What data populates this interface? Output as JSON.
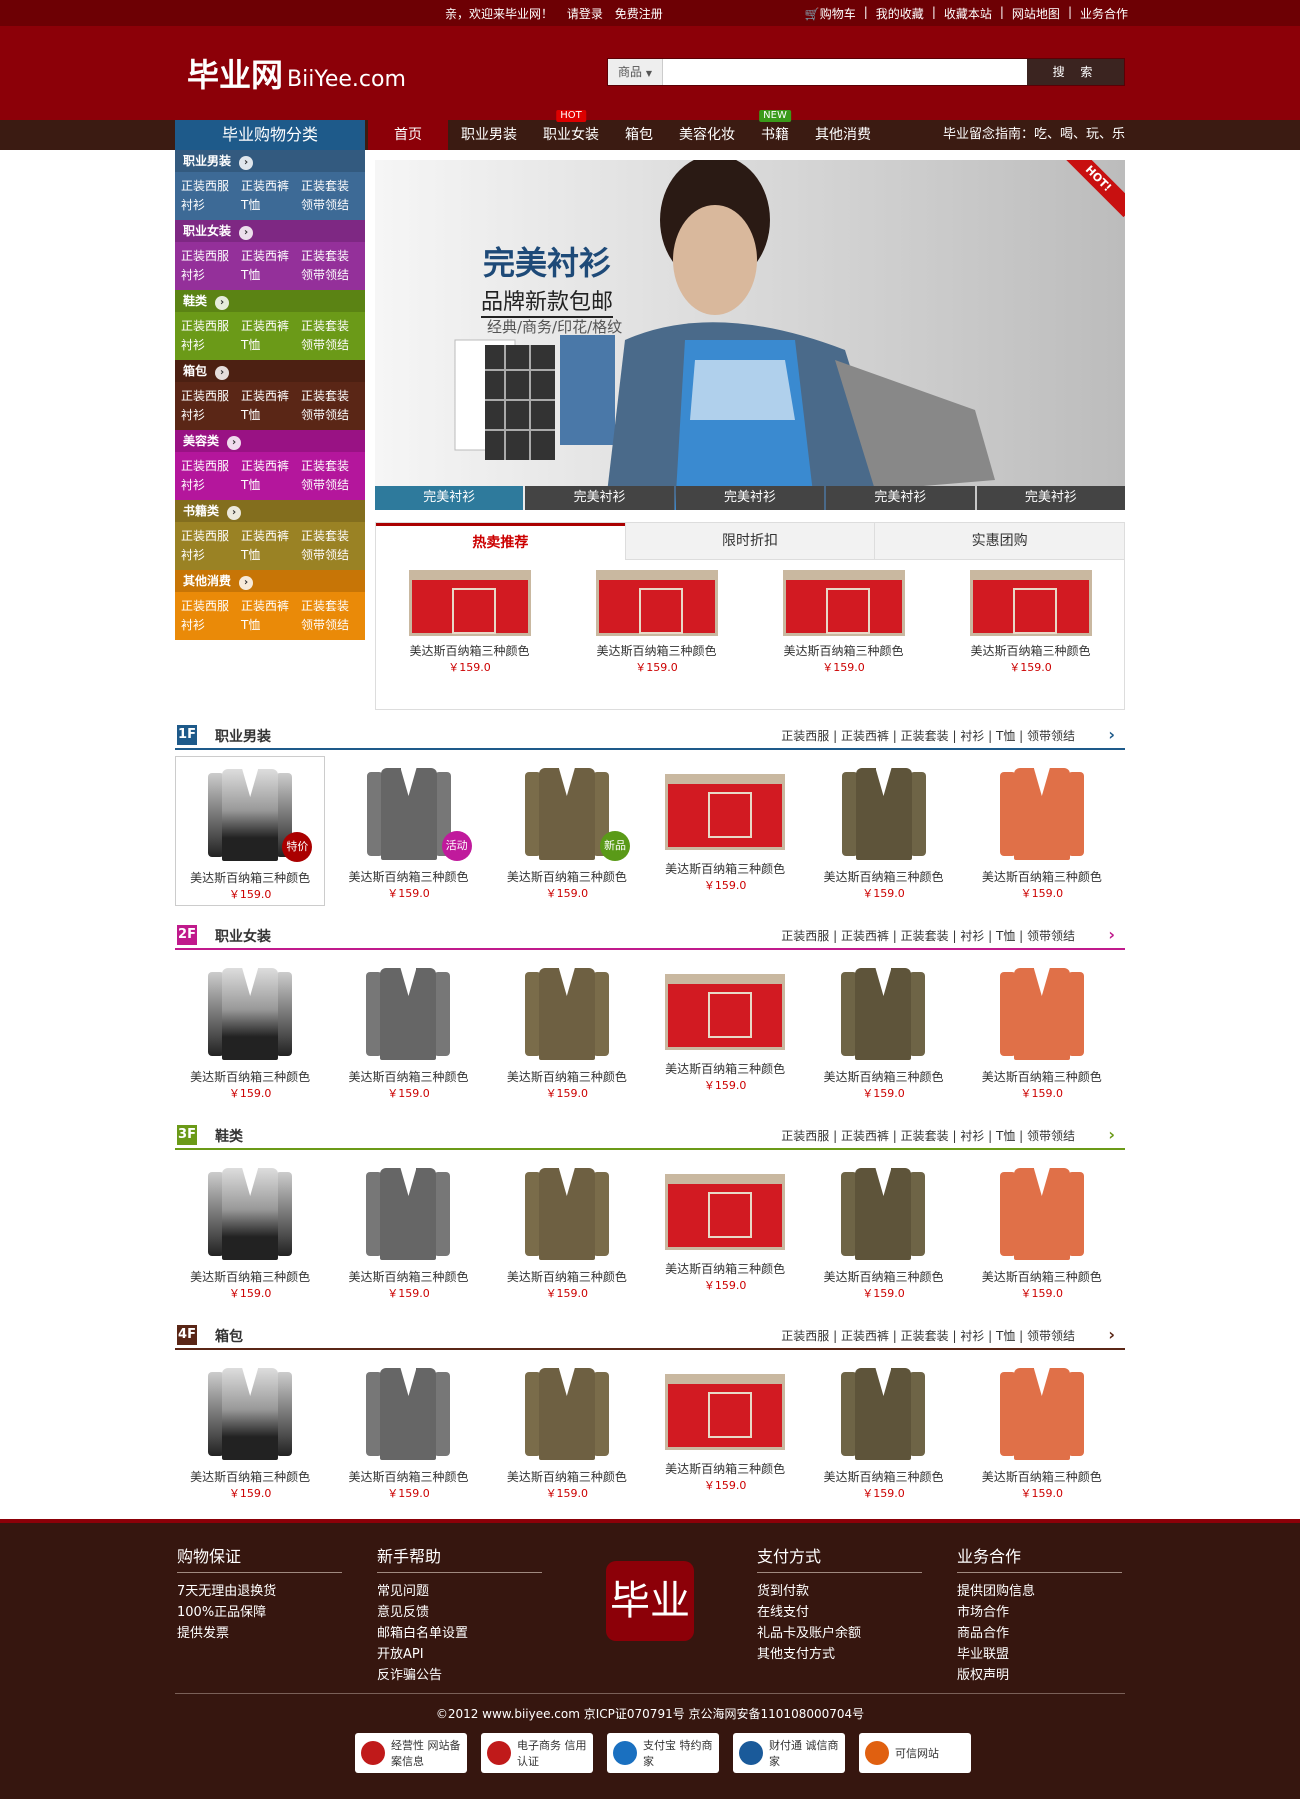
{
  "topbar": {
    "welcome": "亲，欢迎来毕业网！",
    "login": "请登录",
    "register": "免费注册",
    "links": [
      "购物车",
      "我的收藏",
      "收藏本站",
      "网站地图",
      "业务合作"
    ]
  },
  "logo": {
    "cn": "毕业网",
    "en": "BiiYee.com"
  },
  "search": {
    "category": "商品",
    "button": "搜 索",
    "placeholder": ""
  },
  "nav": {
    "category_title": "毕业购物分类",
    "items": [
      {
        "label": "首页",
        "badge": ""
      },
      {
        "label": "职业男装",
        "badge": ""
      },
      {
        "label": "职业女装",
        "badge": "HOT"
      },
      {
        "label": "箱包",
        "badge": ""
      },
      {
        "label": "美容化妆",
        "badge": ""
      },
      {
        "label": "书籍",
        "badge": "NEW"
      },
      {
        "label": "其他消费",
        "badge": ""
      }
    ],
    "guide": "毕业留念指南：吃、喝、玩、乐"
  },
  "sidebar": [
    {
      "title": "职业男装",
      "color": "#3d6a96"
    },
    {
      "title": "职业女装",
      "color": "#94309a"
    },
    {
      "title": "鞋类",
      "color": "#6b9a18"
    },
    {
      "title": "箱包",
      "color": "#5a2616"
    },
    {
      "title": "美容类",
      "color": "#b4169c"
    },
    {
      "title": "书籍类",
      "color": "#9a8224"
    },
    {
      "title": "其他消费",
      "color": "#ea8a08"
    }
  ],
  "sidebar_links": [
    "正装西服",
    "正装西裤",
    "正装套装",
    "衬衫",
    "T恤",
    "领带领结"
  ],
  "banner": {
    "title": "完美衬衫",
    "subtitle": "品牌新款包邮",
    "desc": "经典/商务/印花/格纹",
    "hot": "HOT!",
    "tabs": [
      "完美衬衫",
      "完美衬衫",
      "完美衬衫",
      "完美衬衫",
      "完美衬衫"
    ]
  },
  "hot": {
    "tabs": [
      "热卖推荐",
      "限时折扣",
      "实惠团购"
    ],
    "products": [
      {
        "name": "美达斯百纳箱三种颜色",
        "price": "￥159.0"
      },
      {
        "name": "美达斯百纳箱三种颜色",
        "price": "￥159.0"
      },
      {
        "name": "美达斯百纳箱三种颜色",
        "price": "￥159.0"
      },
      {
        "name": "美达斯百纳箱三种颜色",
        "price": "￥159.0"
      }
    ]
  },
  "floors": [
    {
      "num": "1F",
      "title": "职业男装",
      "color": "#1e5a8a"
    },
    {
      "num": "2F",
      "title": "职业女装",
      "color": "#c01a8c"
    },
    {
      "num": "3F",
      "title": "鞋类",
      "color": "#6b9a18"
    },
    {
      "num": "4F",
      "title": "箱包",
      "color": "#5a2616"
    }
  ],
  "floor_links": "正装西服 | 正装西裤 | 正装套装 | 衬衫 | T恤 | 领带领结",
  "floor_product": {
    "name": "美达斯百纳箱三种颜色",
    "price": "￥159.0"
  },
  "floor_tags": [
    "特价",
    "活动",
    "新品"
  ],
  "footer": {
    "cols": [
      {
        "title": "购物保证",
        "links": [
          "7天无理由退换货",
          "100%正品保障",
          "提供发票"
        ]
      },
      {
        "title": "新手帮助",
        "links": [
          "常见问题",
          "意见反馈",
          "邮箱白名单设置",
          "开放API",
          "反诈骗公告"
        ]
      },
      {
        "title": "支付方式",
        "links": [
          "货到付款",
          "在线支付",
          "礼品卡及账户余额",
          "其他支付方式"
        ]
      },
      {
        "title": "业务合作",
        "links": [
          "提供团购信息",
          "市场合作",
          "商品合作",
          "毕业联盟",
          "版权声明"
        ]
      }
    ],
    "logo": "毕业",
    "copyright": "©2012 www.biiyee.com 京ICP证070791号 京公海网安备110108000704号",
    "badges": [
      "经营性 网站备案信息",
      "电子商务 信用认证",
      "支付宝 特约商家",
      "财付通 诚信商家",
      "可信网站"
    ]
  }
}
